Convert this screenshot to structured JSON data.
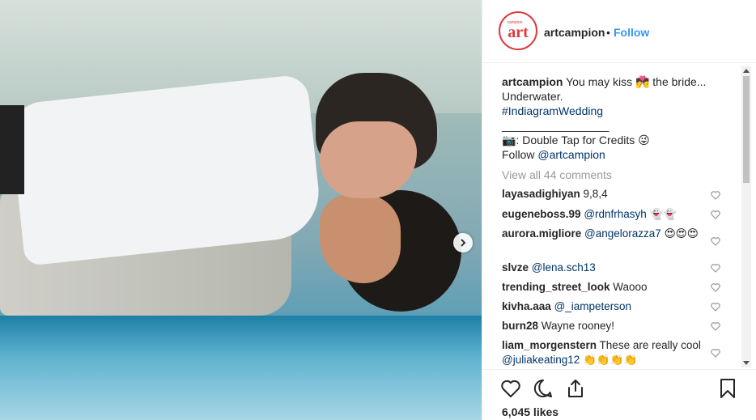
{
  "post": {
    "username": "artcampion",
    "dot": "•",
    "follow_label": "Follow",
    "avatar_text": "art",
    "avatar_small": "campion"
  },
  "caption": {
    "user": "artcampion",
    "line1": "You may kiss 💏 the bride...",
    "line2": "Underwater.",
    "hashtag": "#IndiagramWedding",
    "divider": "_________________",
    "line3": "📷: Double Tap for Credits 😜",
    "follow_text": "Follow",
    "mention": "@artcampion"
  },
  "view_all": "View all 44 comments",
  "comments": [
    {
      "user": "layasadighiyan",
      "text": " 9,8,4",
      "mention": "",
      "text2": ""
    },
    {
      "user": "eugeneboss.99",
      "text": " ",
      "mention": "@rdnfrhasyh",
      "text2": " 👻👻"
    },
    {
      "user": "aurora.migliore",
      "text": " ",
      "mention": "@angelorazza7",
      "text2": " 😍😍😍"
    },
    {
      "user": "slvze",
      "text": " ",
      "mention": "@lena.sch13",
      "text2": ""
    },
    {
      "user": "trending_street_look",
      "text": " Waooo",
      "mention": "",
      "text2": ""
    },
    {
      "user": "kivha.aaa",
      "text": " ",
      "mention": "@_iampeterson",
      "text2": ""
    },
    {
      "user": "burn28",
      "text": " Wayne rooney!",
      "mention": "",
      "text2": ""
    },
    {
      "user": "liam_morgenstern",
      "text": " These are really cool ",
      "mention": "@juliakeating12",
      "text2": " 👏👏👏👏"
    }
  ],
  "likes": "6,045 likes",
  "icons": {
    "like": "heart-icon",
    "comment": "comment-icon",
    "share": "share-icon",
    "save": "bookmark-icon",
    "next": "chevron-right-icon"
  },
  "colors": {
    "link": "#3897f0",
    "hashtag": "#003569",
    "brand": "#e03a3e"
  }
}
